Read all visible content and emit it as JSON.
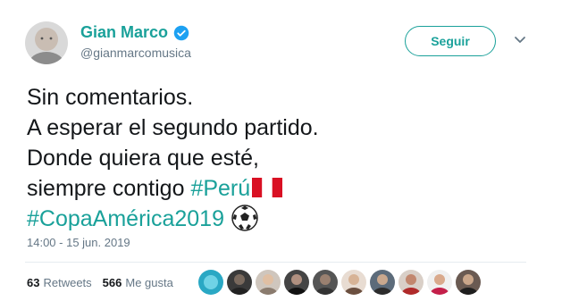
{
  "tweet": {
    "author_name": "Gian Marco",
    "author_handle": "@gianmarcomusica",
    "follow_label": "Seguir",
    "lines": [
      "Sin comentarios.",
      "A esperar el segundo partido.",
      "Donde quiera que esté,"
    ],
    "line4_text": "siempre contigo ",
    "hashtag_peru": "#Perú",
    "hashtag_copa": "#CopaAmérica2019",
    "timestamp": "14:00 - 15 jun. 2019",
    "retweets_count": "63",
    "retweets_label": "Retweets",
    "likes_count": "566",
    "likes_label": "Me gusta"
  },
  "colors": {
    "accent": "#1aa19a",
    "verified": "#1da1f2",
    "text": "#14171a",
    "secondary": "#657786",
    "divider": "#e6ecf0"
  },
  "icons": {
    "verified": "verified-badge-icon",
    "chevron": "chevron-down-icon",
    "flag": "peru-flag-emoji",
    "ball": "soccer-ball-emoji"
  },
  "liked_by_avatars": 10
}
